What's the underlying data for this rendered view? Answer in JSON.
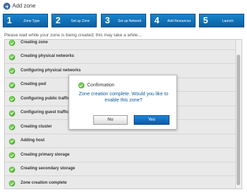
{
  "header": {
    "title": "Add zone",
    "icon": "add-zone-icon"
  },
  "steps": [
    {
      "number": "1",
      "label": "Zone Type"
    },
    {
      "number": "2",
      "label": "Set up Zone"
    },
    {
      "number": "3",
      "label": "Set up Network"
    },
    {
      "number": "4",
      "label": "Add Resources"
    },
    {
      "number": "5",
      "label": "Launch"
    }
  ],
  "wait_message": "Please wait while your zone is being created; this may take a while...",
  "progress_items": [
    {
      "label": "Creating zone",
      "status": "complete"
    },
    {
      "label": "Creating physical networks",
      "status": "complete"
    },
    {
      "label": "Configuring physical networks",
      "status": "complete"
    },
    {
      "label": "Creating pod",
      "status": "complete"
    },
    {
      "label": "Configuring public traffic",
      "status": "complete"
    },
    {
      "label": "Configuring guest traffic",
      "status": "complete"
    },
    {
      "label": "Creating cluster",
      "status": "complete"
    },
    {
      "label": "Adding host",
      "status": "complete"
    },
    {
      "label": "Creating primary storage",
      "status": "complete"
    },
    {
      "label": "Creating secondary storage",
      "status": "complete"
    },
    {
      "label": "Zone creation complete",
      "status": "complete"
    }
  ],
  "dialog": {
    "title": "Confirmation",
    "message": "Zone creation complete. Would you like to enable this zone?",
    "no_label": "No",
    "yes_label": "Yes"
  },
  "colors": {
    "step_blue": "#0a5fa5",
    "success_green": "#3a9b1e",
    "message_blue": "#0b5a99"
  }
}
